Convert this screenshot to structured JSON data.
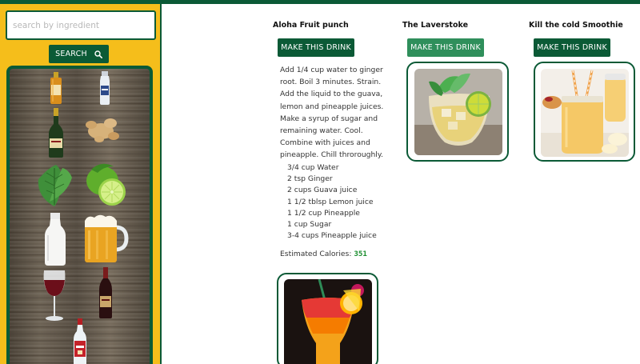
{
  "search": {
    "placeholder": "search by ingredient",
    "button_label": "SEARCH"
  },
  "sidebar": {
    "ingredients": [
      "bourbon-bottle",
      "vodka-bottle",
      "champagne-bottle",
      "ginger-root",
      "mint-leaves",
      "lime",
      "milk-bottle",
      "beer-mug",
      "red-wine-glass",
      "wine-bottle",
      "smirnoff-bottle"
    ]
  },
  "drinks": [
    {
      "title": "Aloha Fruit punch",
      "button_label": "MAKE THIS DRINK",
      "expanded": true,
      "instructions": "Add 1/4 cup water to ginger root. Boil 3 minutes. Strain. Add the liquid to the guava, lemon and pineapple juices. Make a syrup of sugar and remaining water. Cool. Combine with juices and pineapple. Chill throroughly.",
      "ingredients": [
        "3/4 cup Water",
        "2 tsp Ginger",
        "2 cups Guava juice",
        "1 1/2 tblsp Lemon juice",
        "1 1/2 cup Pineapple",
        "1 cup Sugar",
        "3-4 cups Pineapple juice"
      ],
      "calories_label": "Estimated Calories:",
      "calories_value": "351",
      "image": "tropical-cocktail"
    },
    {
      "title": "The Laverstoke",
      "button_label": "MAKE THIS DRINK",
      "expanded": false,
      "image": "lime-mint-cocktail"
    },
    {
      "title": "Kill the cold Smoothie",
      "button_label": "MAKE THIS DRINK",
      "expanded": false,
      "image": "banana-smoothie"
    }
  ],
  "colors": {
    "brand_green": "#0b5a36",
    "sidebar_yellow": "#f5be1b",
    "calorie_green": "#1b8e2f"
  }
}
